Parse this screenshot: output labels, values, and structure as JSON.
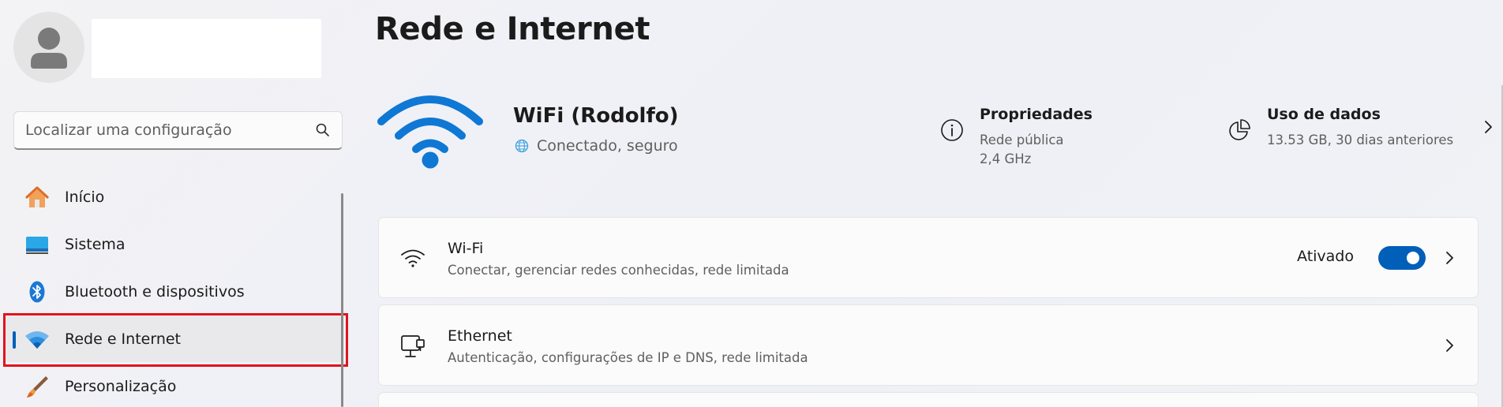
{
  "sidebar": {
    "search": {
      "placeholder": "Localizar uma configuração"
    },
    "items": [
      {
        "label": "Início",
        "icon": "home-icon",
        "active": false
      },
      {
        "label": "Sistema",
        "icon": "system-monitor-icon",
        "active": false
      },
      {
        "label": "Bluetooth e dispositivos",
        "icon": "bluetooth-icon",
        "active": false
      },
      {
        "label": "Rede e Internet",
        "icon": "wifi-icon",
        "active": true
      },
      {
        "label": "Personalização",
        "icon": "brush-icon",
        "active": false
      }
    ]
  },
  "main": {
    "title": "Rede e Internet",
    "hero": {
      "network_name": "WiFi (Rodolfo)",
      "status": "Conectado, seguro",
      "properties": {
        "title": "Propriedades",
        "line1": "Rede pública",
        "line2": "2,4 GHz"
      },
      "data_usage": {
        "title": "Uso de dados",
        "line1": "13.53 GB, 30 dias anteriores"
      }
    },
    "cards": {
      "wifi": {
        "title": "Wi-Fi",
        "subtitle": "Conectar, gerenciar redes conhecidas, rede limitada",
        "toggle_label": "Ativado",
        "toggle_on": true
      },
      "ethernet": {
        "title": "Ethernet",
        "subtitle": "Autenticação, configurações de IP e DNS, rede limitada"
      }
    }
  },
  "colors": {
    "accent": "#005fb8",
    "wifi_blue": "#0f78d4",
    "highlight_red": "#e0141e"
  }
}
